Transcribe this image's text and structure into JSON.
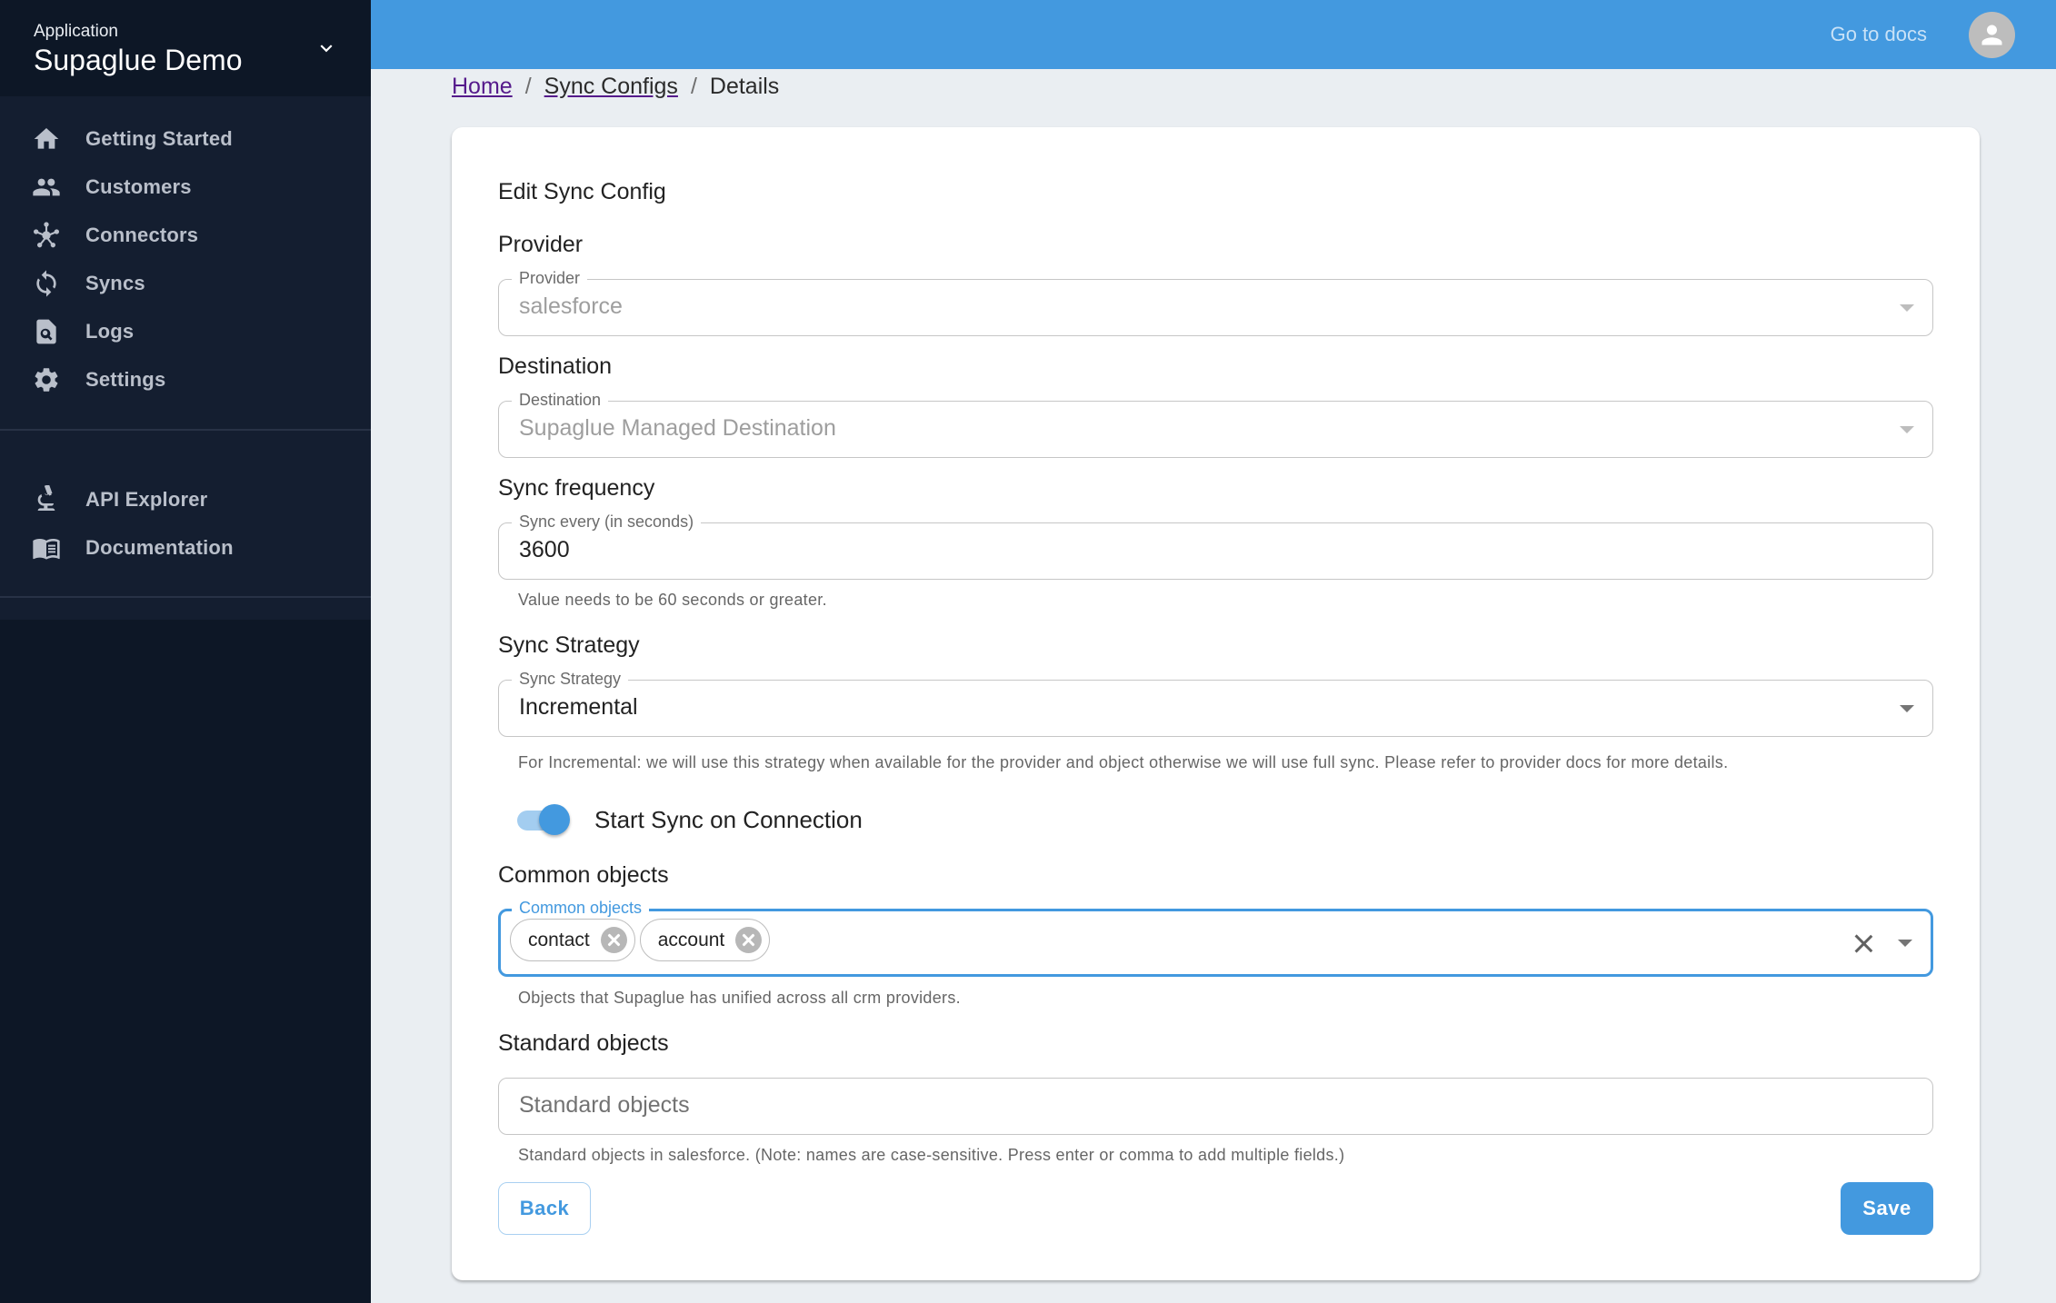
{
  "sidebar": {
    "app_label": "Application",
    "app_name": "Supaglue Demo",
    "nav_items": [
      {
        "label": "Getting Started",
        "icon": "home-icon"
      },
      {
        "label": "Customers",
        "icon": "people-icon"
      },
      {
        "label": "Connectors",
        "icon": "hub-icon"
      },
      {
        "label": "Syncs",
        "icon": "sync-icon"
      },
      {
        "label": "Logs",
        "icon": "file-search-icon"
      },
      {
        "label": "Settings",
        "icon": "gear-icon"
      }
    ],
    "secondary_items": [
      {
        "label": "API Explorer",
        "icon": "microscope-icon"
      },
      {
        "label": "Documentation",
        "icon": "book-icon"
      }
    ]
  },
  "header": {
    "docs_link": "Go to docs",
    "avatar_icon": "user-avatar-icon",
    "colors": {
      "bar": "#4399df"
    }
  },
  "breadcrumb": {
    "home": "Home",
    "sync_configs": "Sync Configs",
    "current": "Details",
    "separator": "/"
  },
  "form": {
    "title": "Edit Sync Config",
    "provider": {
      "section": "Provider",
      "label": "Provider",
      "value": "salesforce",
      "disabled": true
    },
    "destination": {
      "section": "Destination",
      "label": "Destination",
      "value": "Supaglue Managed Destination",
      "disabled": true
    },
    "sync_frequency": {
      "section": "Sync frequency",
      "label": "Sync every (in seconds)",
      "value": "3600",
      "helper": "Value needs to be 60 seconds or greater."
    },
    "sync_strategy": {
      "section": "Sync Strategy",
      "label": "Sync Strategy",
      "value": "Incremental",
      "helper": "For Incremental: we will use this strategy when available for the provider and object otherwise we will use full sync. Please refer to provider docs for more details."
    },
    "start_sync_toggle": {
      "label": "Start Sync on Connection",
      "checked": true
    },
    "common_objects": {
      "section": "Common objects",
      "label": "Common objects",
      "chips": [
        "contact",
        "account"
      ],
      "helper": "Objects that Supaglue has unified across all crm providers."
    },
    "standard_objects": {
      "section": "Standard objects",
      "placeholder": "Standard objects",
      "value": "",
      "helper": "Standard objects in salesforce. (Note: names are case-sensitive. Press enter or comma to add multiple fields.)"
    },
    "back_label": "Back",
    "save_label": "Save",
    "accent_color": "#4399df"
  }
}
